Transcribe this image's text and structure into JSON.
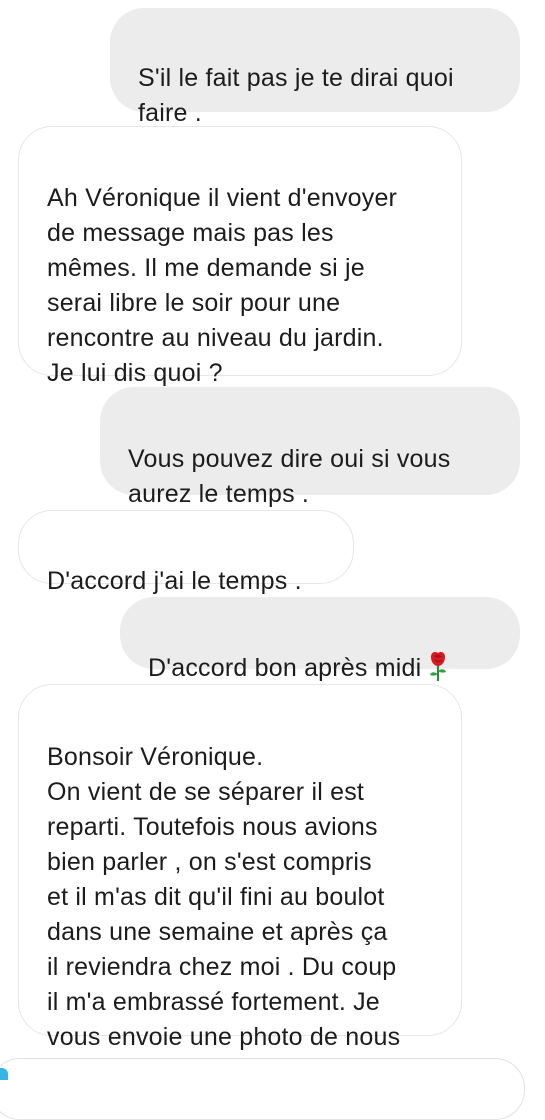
{
  "messages": [
    {
      "id": 1,
      "direction": "sent",
      "text": "S'il le fait pas je te dirai quoi\nfaire ."
    },
    {
      "id": 2,
      "direction": "received",
      "text": "Ah Véronique il vient d'envoyer\nde message mais pas les\nmêmes. Il me demande si je\nserai libre le soir pour une\nrencontre au niveau du jardin.\nJe lui dis quoi ?"
    },
    {
      "id": 3,
      "direction": "sent",
      "text": "Vous pouvez dire oui si vous\naurez le temps ."
    },
    {
      "id": 4,
      "direction": "received",
      "text": "D'accord j'ai le temps ."
    },
    {
      "id": 5,
      "direction": "sent",
      "text": "D'accord bon après midi",
      "emoji": "rose-emoji"
    },
    {
      "id": 6,
      "direction": "received",
      "text": "Bonsoir Véronique.\nOn vient de se séparer il est\nreparti. Toutefois nous avions\nbien parler , on s'est compris\net il m'as dit qu'il fini au boulot\ndans une semaine et après ça\nil reviendra chez moi . Du coup\nil m'a embrassé fortement. Je\nvous envoie une photo de nous"
    }
  ],
  "colors": {
    "sent_bubble": "#ececec",
    "received_bubble": "#ffffff",
    "received_border": "#e6e6e6",
    "accent": "#35b7e6"
  }
}
